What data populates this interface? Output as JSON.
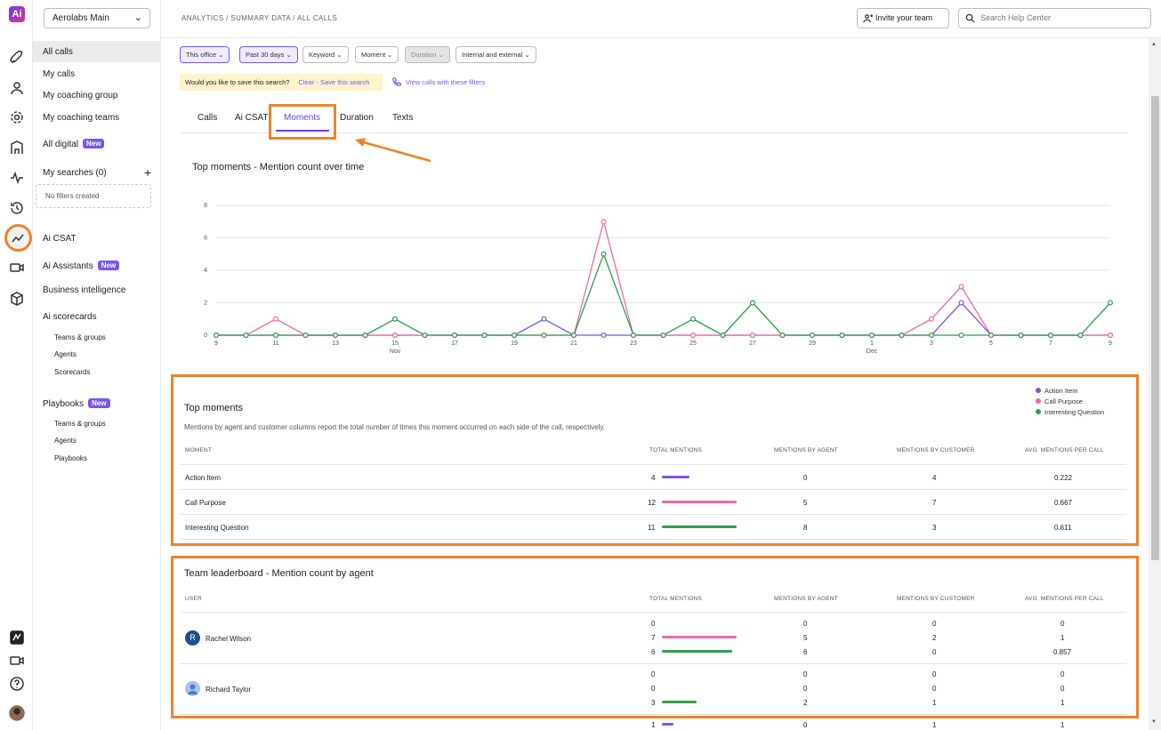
{
  "app": {
    "workspace": "Aerolabs Main"
  },
  "breadcrumb": "ANALYTICS / SUMMARY DATA / ALL CALLS",
  "header": {
    "invite_label": "Invite your team",
    "search_placeholder": "Search Help Center"
  },
  "sidebar": {
    "items": [
      {
        "label": "All calls"
      },
      {
        "label": "My calls"
      },
      {
        "label": "My coaching group"
      },
      {
        "label": "My coaching teams"
      },
      {
        "label": "All digital",
        "badge": "New"
      }
    ],
    "my_searches": "My searches (0)",
    "no_filters": "No filters created",
    "ai_csat": "Ai CSAT",
    "ai_assistants": "Ai Assistants",
    "ai_assistants_badge": "New",
    "business_intelligence": "Business intelligence",
    "ai_scorecards": "Ai scorecards",
    "scorecard_sub": [
      "Teams & groups",
      "Agents",
      "Scorecards"
    ],
    "playbooks": "Playbooks",
    "playbooks_badge": "New",
    "playbooks_sub": [
      "Teams & groups",
      "Agents",
      "Playbooks"
    ]
  },
  "filters": [
    "This office",
    "Past 30 days",
    "Keyword",
    "Moment",
    "Duration",
    "Internal and external"
  ],
  "save_prompt": {
    "question": "Would you like to save this search?",
    "link": "Clear - Save this search"
  },
  "view_calls": "View calls with these filters",
  "tabs": [
    "Calls",
    "Ai CSAT",
    "Moments",
    "Duration",
    "Texts"
  ],
  "chart_title": "Top moments - Mention count over time",
  "colors": {
    "action_item": "#7b55f0",
    "call_purpose": "#ec6aa6",
    "interesting_question": "#2e9e4f",
    "highlight": "#f0822a"
  },
  "chart_data": {
    "type": "line",
    "title": "Top moments - Mention count over time",
    "x": [
      9,
      10,
      11,
      12,
      13,
      14,
      15,
      16,
      17,
      18,
      19,
      20,
      21,
      22,
      23,
      24,
      25,
      26,
      27,
      28,
      29,
      30,
      1,
      2,
      3,
      4,
      5,
      6,
      7,
      8,
      9
    ],
    "x_tick_labels": [
      "9",
      "11",
      "13",
      "15",
      "17",
      "19",
      "21",
      "23",
      "25",
      "27",
      "29",
      "1",
      "3",
      "5",
      "7",
      "9"
    ],
    "month_labels": [
      "Nov",
      "Dec"
    ],
    "ylim": [
      0,
      8
    ],
    "y_ticks": [
      "0",
      "2",
      "4",
      "6",
      "8"
    ],
    "grid": true,
    "series": [
      {
        "name": "Action Item",
        "values": [
          0,
          0,
          0,
          0,
          0,
          0,
          0,
          0,
          0,
          0,
          0,
          1,
          0,
          0,
          0,
          0,
          0,
          0,
          0,
          0,
          0,
          0,
          0,
          0,
          0,
          2,
          0,
          0,
          0,
          0,
          0
        ]
      },
      {
        "name": "Call Purpose",
        "values": [
          0,
          0,
          1,
          0,
          0,
          0,
          0,
          0,
          0,
          0,
          0,
          0,
          0,
          7,
          0,
          0,
          0,
          0,
          0,
          0,
          0,
          0,
          0,
          0,
          1,
          3,
          0,
          0,
          0,
          0,
          0
        ]
      },
      {
        "name": "Interesting Question",
        "values": [
          0,
          0,
          0,
          0,
          0,
          0,
          1,
          0,
          0,
          0,
          0,
          0,
          0,
          5,
          0,
          0,
          1,
          0,
          2,
          0,
          0,
          0,
          0,
          0,
          0,
          0,
          0,
          0,
          0,
          0,
          2
        ]
      }
    ]
  },
  "legend": [
    "Action Item",
    "Call Purpose",
    "Interesting Question"
  ],
  "top_moments": {
    "title": "Top moments",
    "description": "Mentions by agent and customer columns report the total number of times this moment occurred on each side of the call, respectively.",
    "headers": [
      "MOMENT",
      "TOTAL MENTIONS",
      "MENTIONS BY AGENT",
      "MENTIONS BY CUSTOMER",
      "AVG. MENTIONS PER CALL"
    ],
    "rows": [
      {
        "moment": "Action Item",
        "total": "4",
        "agent": "0",
        "customer": "4",
        "avg": "0.222"
      },
      {
        "moment": "Call Purpose",
        "total": "12",
        "agent": "5",
        "customer": "7",
        "avg": "0.667"
      },
      {
        "moment": "Interesting Question",
        "total": "11",
        "agent": "8",
        "customer": "3",
        "avg": "0.611"
      }
    ]
  },
  "leaderboard": {
    "title": "Team leaderboard - Mention count by agent",
    "headers": [
      "USER",
      "TOTAL MENTIONS",
      "MENTIONS BY AGENT",
      "MENTIONS BY CUSTOMER",
      "AVG. MENTIONS PER CALL"
    ],
    "users": [
      {
        "name": "Rachel Wilson",
        "initial": "R",
        "rows": [
          {
            "total": "0",
            "agent": "0",
            "customer": "0",
            "avg": "0"
          },
          {
            "total": "7",
            "agent": "5",
            "customer": "2",
            "avg": "1"
          },
          {
            "total": "6",
            "agent": "6",
            "customer": "0",
            "avg": "0.857"
          }
        ]
      },
      {
        "name": "Richard Taylor",
        "initial": "",
        "rows": [
          {
            "total": "0",
            "agent": "0",
            "customer": "0",
            "avg": "0"
          },
          {
            "total": "0",
            "agent": "0",
            "customer": "0",
            "avg": "0"
          },
          {
            "total": "3",
            "agent": "2",
            "customer": "1",
            "avg": "1"
          }
        ]
      },
      {
        "name": "",
        "initial": "",
        "rows": [
          {
            "total": "1",
            "agent": "0",
            "customer": "1",
            "avg": "1"
          }
        ]
      }
    ]
  }
}
